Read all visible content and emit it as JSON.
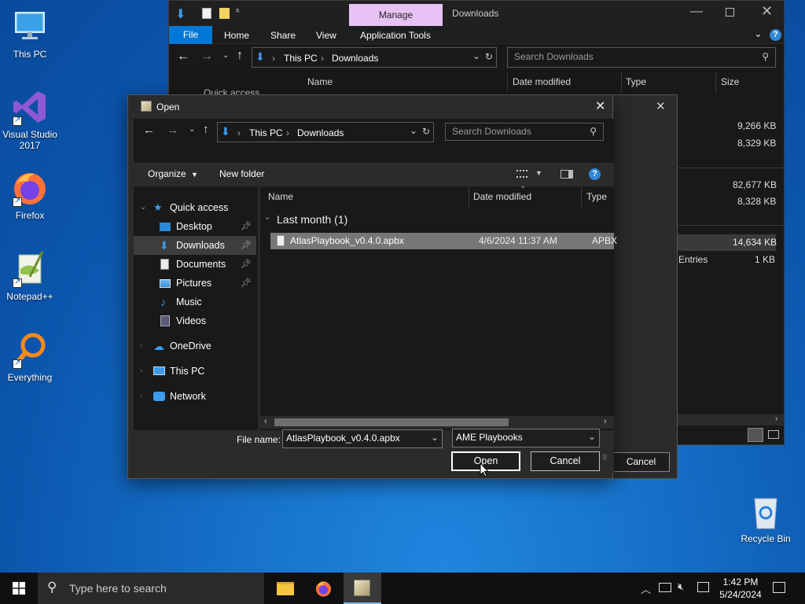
{
  "desktop": {
    "icons": [
      {
        "label": "This PC"
      },
      {
        "label": "Visual Studio 2017"
      },
      {
        "label": "Firefox"
      },
      {
        "label": "Notepad++"
      },
      {
        "label": "Everything"
      },
      {
        "label": "Recycle Bin"
      }
    ]
  },
  "explorer": {
    "manage_tab": "Manage",
    "title": "Downloads",
    "ribbon_tabs": [
      "File",
      "Home",
      "Share",
      "View",
      "Application Tools"
    ],
    "breadcrumb": [
      "This PC",
      "Downloads"
    ],
    "search_placeholder": "Search Downloads",
    "columns": [
      "Name",
      "Date modified",
      "Type",
      "Size"
    ],
    "quick_access_partial": "Quick access",
    "partial_text_ect": "ect",
    "sizes": [
      "9,266 KB",
      "8,329 KB",
      "82,677 KB",
      "8,328 KB",
      "14,634 KB",
      "1 KB"
    ],
    "entries_text": "Entries",
    "cancel_label": "Cancel"
  },
  "dialog": {
    "title": "Open",
    "breadcrumb": [
      "This PC",
      "Downloads"
    ],
    "search_placeholder": "Search Downloads",
    "toolbar": {
      "organize": "Organize",
      "new_folder": "New folder"
    },
    "nav_items": [
      {
        "label": "Quick access",
        "icon": "star-icon"
      },
      {
        "label": "Desktop",
        "icon": "desktop-folder-icon"
      },
      {
        "label": "Downloads",
        "icon": "download-arrow-icon"
      },
      {
        "label": "Documents",
        "icon": "document-icon"
      },
      {
        "label": "Pictures",
        "icon": "pictures-icon"
      },
      {
        "label": "Music",
        "icon": "music-note-icon"
      },
      {
        "label": "Videos",
        "icon": "video-icon"
      },
      {
        "label": "OneDrive",
        "icon": "cloud-icon"
      },
      {
        "label": "This PC",
        "icon": "monitor-icon"
      },
      {
        "label": "Network",
        "icon": "network-icon"
      }
    ],
    "columns": [
      "Name",
      "Date modified",
      "Type"
    ],
    "group_header": "Last month (1)",
    "files": [
      {
        "name": "AtlasPlaybook_v0.4.0.apbx",
        "date": "4/6/2024 11:37 AM",
        "type": "APBX"
      }
    ],
    "filename_label": "File name:",
    "filename_value": "AtlasPlaybook_v0.4.0.apbx",
    "filetype_value": "AME Playbooks",
    "open_label": "Open",
    "cancel_label": "Cancel"
  },
  "taskbar": {
    "search_placeholder": "Type here to search",
    "time": "1:42 PM",
    "date": "5/24/2024"
  },
  "colors": {
    "selection": "#777777",
    "accent_blue": "#0078d7",
    "manage_tab": "#e7c3f5"
  }
}
